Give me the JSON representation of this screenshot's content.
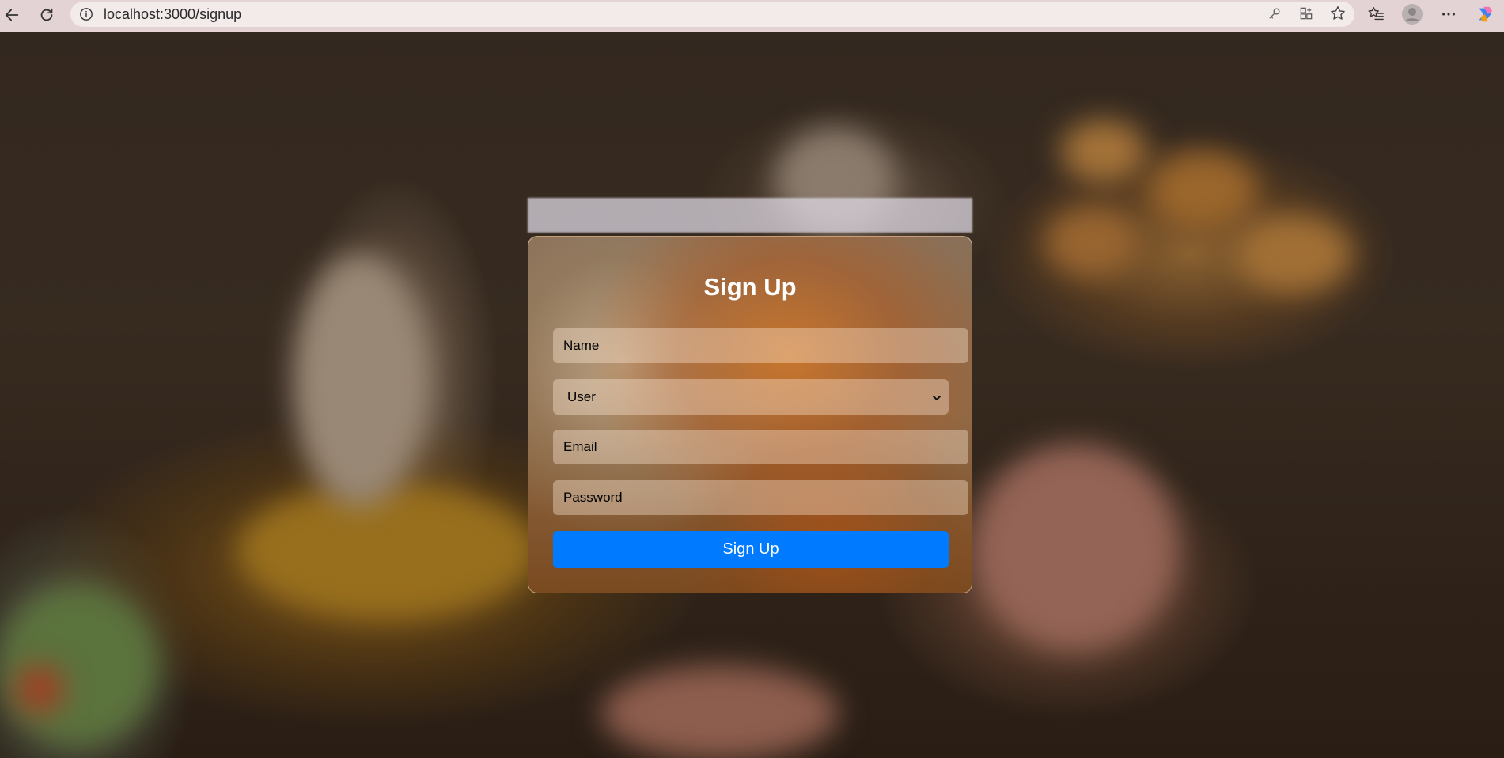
{
  "browser": {
    "url": "localhost:3000/signup",
    "icons": [
      "back-icon",
      "reload-icon",
      "info-icon",
      "key-icon",
      "apps-icon",
      "star-icon",
      "favorites-icon",
      "profile-icon",
      "more-icon",
      "copilot-icon"
    ]
  },
  "form": {
    "title": "Sign Up",
    "name_placeholder": "Name",
    "role_selected": "User",
    "email_placeholder": "Email",
    "password_placeholder": "Password",
    "submit_label": "Sign Up"
  },
  "colors": {
    "accent": "#007bff",
    "chrome": "#e3d3d4"
  }
}
